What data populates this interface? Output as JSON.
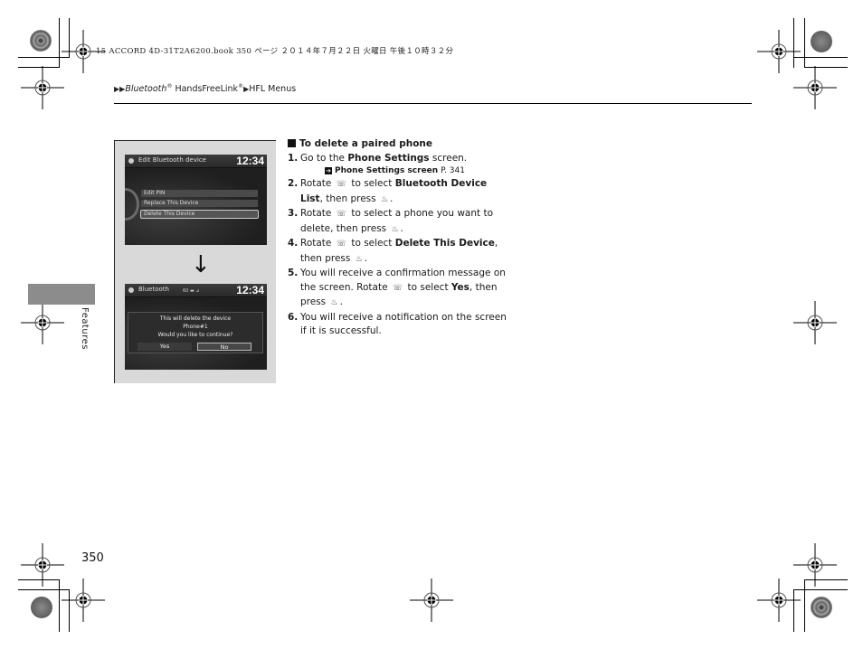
{
  "print_header": "15 ACCORD 4D-31T2A6200.book  350 ページ  ２０１４年７月２２日  火曜日  午後１０時３２分",
  "breadcrumb": {
    "items": [
      "Bluetooth",
      "HandsFreeLink",
      "HFL Menus"
    ],
    "registered_mark": "®",
    "separator_icon": "triangle-right-icon"
  },
  "side_tab": {
    "label": "Features"
  },
  "page_number": "350",
  "figure": {
    "screen1": {
      "title": "Edit Bluetooth device",
      "clock": "12:34",
      "menu_items": [
        "Edit PIN",
        "Replace This Device",
        "Delete This Device"
      ],
      "selected_index": 2
    },
    "arrow_icon": "↓",
    "screen2": {
      "title": "Bluetooth",
      "clock": "12:34",
      "status": "60 ▬ ⊿",
      "dialog": {
        "line1": "This will delete the device",
        "line2": "Phone#1",
        "line3": "Would you like to continue?",
        "yes_label": "Yes",
        "no_label": "No",
        "selected": "No"
      }
    }
  },
  "content": {
    "heading": "To delete a paired phone",
    "steps": [
      {
        "num": "1.",
        "pre": "Go to the ",
        "bold": "Phone Settings",
        "post": " screen."
      },
      {
        "num": "2.",
        "pre": "Rotate ",
        "mid": " to select ",
        "bold": "Bluetooth Device List",
        "post": ", then press ",
        "end": "."
      },
      {
        "num": "3.",
        "pre": "Rotate ",
        "mid": " to select a phone you want to delete, then press ",
        "end": "."
      },
      {
        "num": "4.",
        "pre": "Rotate ",
        "mid": " to select ",
        "bold": "Delete This Device",
        "post": ", then press ",
        "end": "."
      },
      {
        "num": "5.",
        "pre": "You will receive a confirmation message on the screen. Rotate ",
        "mid": " to select ",
        "bold": "Yes",
        "post": ", then press ",
        "end": "."
      },
      {
        "num": "6.",
        "pre": "You will receive a notification on the screen if it is successful."
      }
    ],
    "xref": {
      "bold": "Phone Settings screen",
      "page": " P. 341"
    },
    "icons": {
      "rotate": "interface-dial-rotate-icon",
      "press": "interface-dial-press-icon"
    }
  }
}
